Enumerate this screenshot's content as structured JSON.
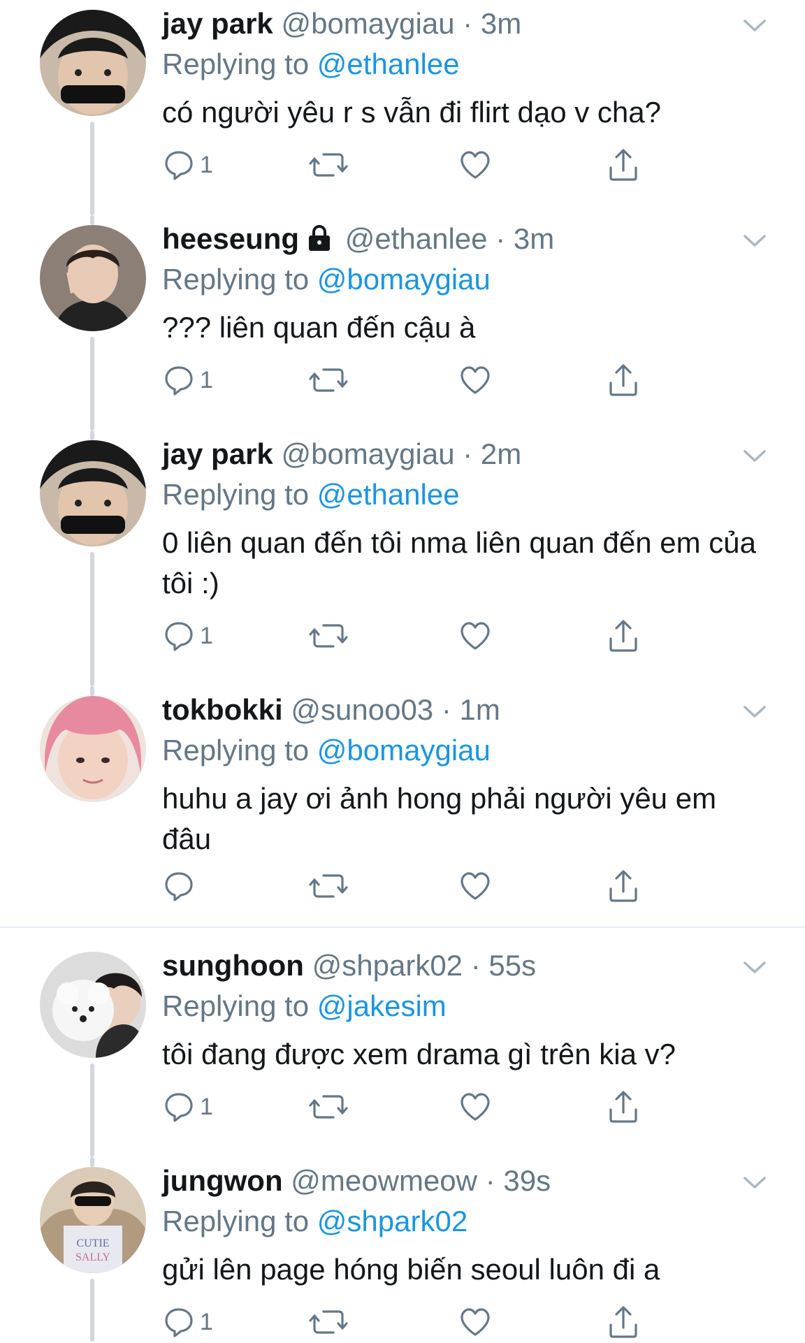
{
  "tweets": [
    {
      "name": "jay park",
      "handle": "@bomaygiau",
      "time": "3m",
      "locked": false,
      "replying_prefix": "Replying to",
      "replying_to": "@ethanlee",
      "text": "có người yêu r s vẫn đi flirt dạo v cha?",
      "reply_count": "1",
      "avatar": "avatar-dark-hair-sunglasses"
    },
    {
      "name": "heeseung",
      "handle": "@ethanlee",
      "time": "3m",
      "locked": true,
      "replying_prefix": "Replying to",
      "replying_to": "@bomaygiau",
      "text": "??? liên quan đến cậu à",
      "reply_count": "1",
      "avatar": "avatar-peace-sign"
    },
    {
      "name": "jay park",
      "handle": "@bomaygiau",
      "time": "2m",
      "locked": false,
      "replying_prefix": "Replying to",
      "replying_to": "@ethanlee",
      "text": "0 liên quan đến tôi nma liên quan đến em của tôi :)",
      "reply_count": "1",
      "avatar": "avatar-dark-hair-sunglasses"
    },
    {
      "name": "tokbokki",
      "handle": "@sunoo03",
      "time": "1m",
      "locked": false,
      "replying_prefix": "Replying to",
      "replying_to": "@bomaygiau",
      "text": "huhu a jay ơi ảnh hong phải người yêu em đâu",
      "reply_count": "",
      "avatar": "avatar-pink-hair"
    },
    {
      "name": "sunghoon",
      "handle": "@shpark02",
      "time": "55s",
      "locked": false,
      "replying_prefix": "Replying to",
      "replying_to": "@jakesim",
      "text": "tôi đang được xem drama gì trên kia v?",
      "reply_count": "1",
      "avatar": "avatar-with-poodle"
    },
    {
      "name": "jungwon",
      "handle": "@meowmeow",
      "time": "39s",
      "locked": false,
      "replying_prefix": "Replying to",
      "replying_to": "@shpark02",
      "text": "gửi lên page hóng biến seoul luôn đi a",
      "reply_count": "1",
      "avatar": "avatar-sunglasses-tshirt"
    }
  ],
  "separator": "·",
  "colors": {
    "mention": "#1b95e0",
    "muted": "#657786",
    "text": "#14171a"
  },
  "icons": [
    "reply-icon",
    "retweet-icon",
    "like-icon",
    "share-icon",
    "chevron-down-icon",
    "lock-icon"
  ]
}
